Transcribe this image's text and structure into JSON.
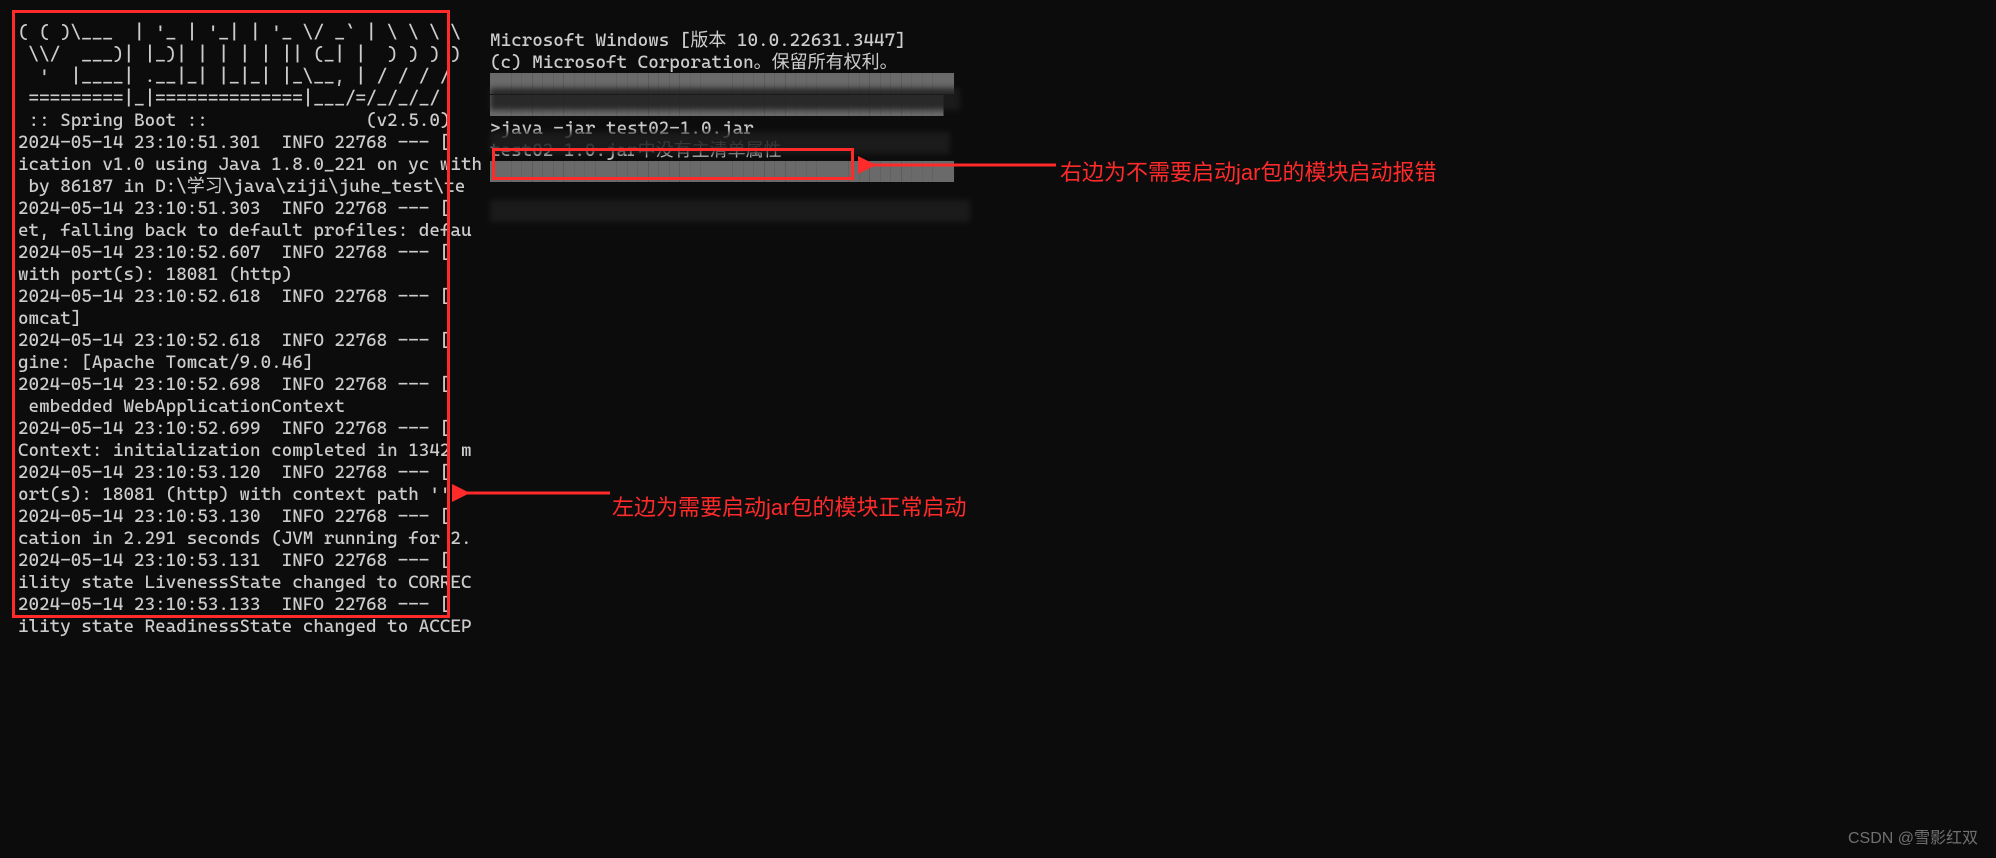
{
  "left_terminal": {
    "banner": "( ( )\\___  | '_ | '_| | '_ \\/ _` | \\ \\ \\ \\\n \\\\/  ___)| |_)| | | | | || (_| |  ) ) ) )\n  '  |____| .__|_| |_|_| |_\\__, | / / / /\n =========|_|==============|___/=/_/_/_/",
    "spring_line": " :: Spring Boot ::               (v2.5.0)",
    "log_lines": [
      "2024-05-14 23:10:51.301  INFO 22768 --- [",
      "ication v1.0 using Java 1.8.0_221 on yc with",
      " by 86187 in D:\\学习\\java\\ziji\\juhe_test\\te",
      "2024-05-14 23:10:51.303  INFO 22768 --- [",
      "et, falling back to default profiles: defau",
      "2024-05-14 23:10:52.607  INFO 22768 --- [",
      "with port(s): 18081 (http)",
      "2024-05-14 23:10:52.618  INFO 22768 --- [",
      "omcat]",
      "2024-05-14 23:10:52.618  INFO 22768 --- [",
      "gine: [Apache Tomcat/9.0.46]",
      "2024-05-14 23:10:52.698  INFO 22768 --- [",
      " embedded WebApplicationContext",
      "2024-05-14 23:10:52.699  INFO 22768 --- [",
      "Context: initialization completed in 1342 m",
      "2024-05-14 23:10:53.120  INFO 22768 --- [",
      "ort(s): 18081 (http) with context path ''",
      "2024-05-14 23:10:53.130  INFO 22768 --- [",
      "cation in 2.291 seconds (JVM running for 2.",
      "2024-05-14 23:10:53.131  INFO 22768 --- [",
      "ility state LivenessState changed to CORREC",
      "2024-05-14 23:10:53.133  INFO 22768 --- [",
      "ility state ReadinessState changed to ACCEP"
    ]
  },
  "right_terminal": {
    "header1": "Microsoft Windows [版本 10.0.22631.3447]",
    "header2": "(c) Microsoft Corporation。保留所有权利。",
    "prompt_suffix": ">java -jar test02-1.0.jar",
    "error_line": "test02-1.0.jar中没有主清单属性"
  },
  "annotations": {
    "right": "右边为不需要启动jar包的模块启动报错",
    "left": "左边为需要启动jar包的模块正常启动"
  },
  "watermark": "CSDN @雪影红双"
}
